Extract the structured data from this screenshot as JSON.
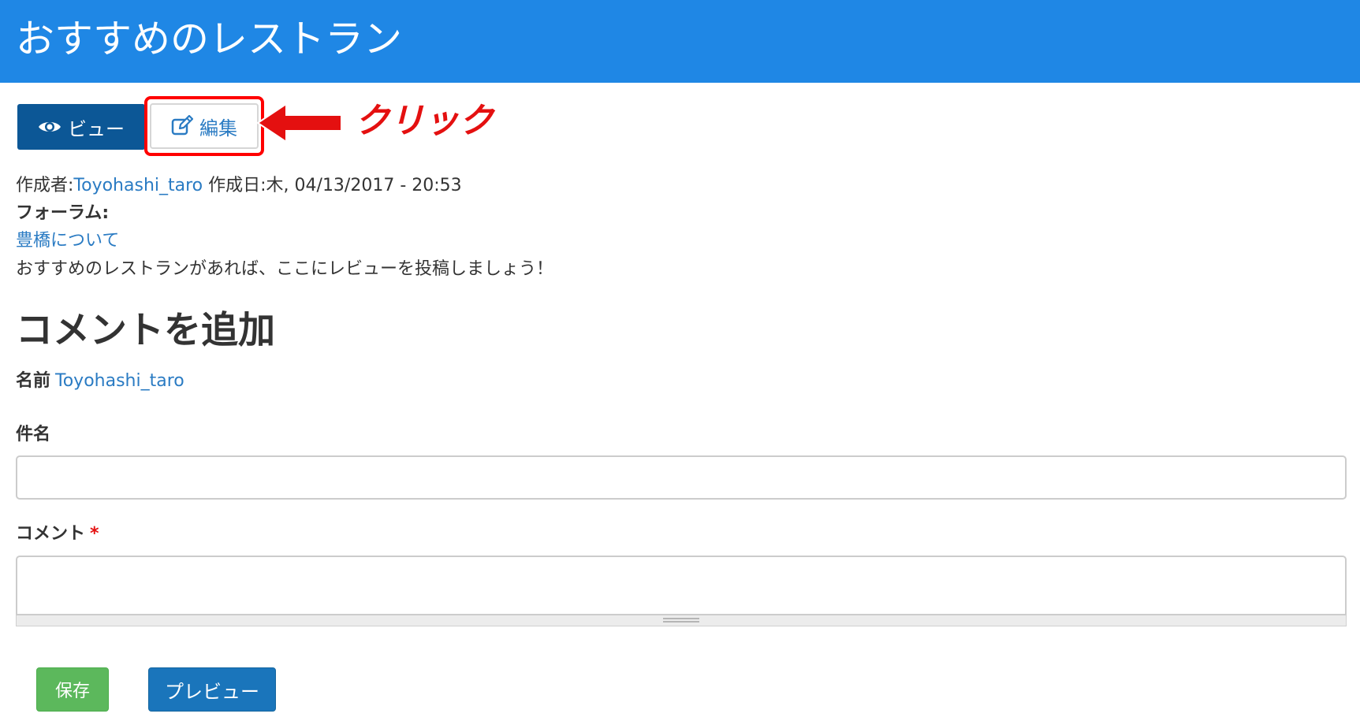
{
  "header": {
    "title": "おすすめのレストラン"
  },
  "tabs": {
    "view_label": "ビュー",
    "edit_label": "編集"
  },
  "annotation": {
    "text": "クリック"
  },
  "meta": {
    "author_prefix": "作成者:",
    "author_name": "Toyohashi_taro",
    "date_prefix": " 作成日:",
    "date_value": "木, 04/13/2017 - 20:53"
  },
  "forum": {
    "label": "フォーラム:",
    "link": "豊橋について"
  },
  "body": {
    "text": "おすすめのレストランがあれば、ここにレビューを投稿しましょう！"
  },
  "comment_form": {
    "heading": "コメントを追加",
    "name_label": "名前",
    "name_value": "Toyohashi_taro",
    "subject_label": "件名",
    "subject_value": "",
    "comment_label": "コメント",
    "required_mark": "*",
    "comment_value": "",
    "save_label": "保存",
    "preview_label": "プレビュー"
  },
  "colors": {
    "header_bg": "#1f87e5",
    "view_tab_bg": "#0c5796",
    "highlight": "#ff0000",
    "link": "#2a7bc3",
    "save_bg": "#5cb85c",
    "preview_bg": "#1a75bb"
  },
  "icons": {
    "view_icon": "eye-icon",
    "edit_icon": "pencil-square-icon",
    "annotation_arrow": "left-arrow-icon"
  }
}
